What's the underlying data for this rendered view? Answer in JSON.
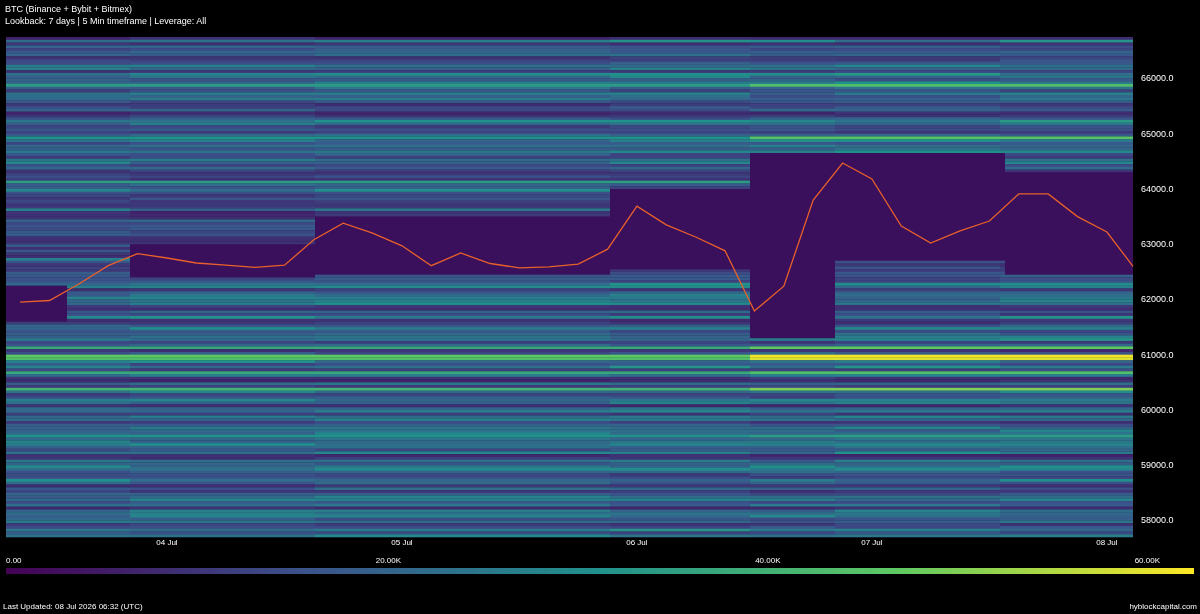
{
  "header": {
    "title": "BTC (Binance + Bybit + Bitmex)",
    "subtitle": "Lookback: 7 days | 5 Min timeframe | Leverage: All"
  },
  "chart": {
    "chart_data": {
      "type": "line",
      "ylim": [
        58000,
        66000
      ],
      "yticks": [
        {
          "value": 66000,
          "label": "66000.0"
        },
        {
          "value": 65000,
          "label": "65000.0"
        },
        {
          "value": 64000,
          "label": "64000.0"
        },
        {
          "value": 63000,
          "label": "63000.0"
        },
        {
          "value": 62000,
          "label": "62000.0"
        },
        {
          "value": 61000,
          "label": "61000.0"
        },
        {
          "value": 60000,
          "label": "60000.0"
        },
        {
          "value": 59000,
          "label": "59000.0"
        },
        {
          "value": 58000,
          "label": "58000.0"
        }
      ],
      "categories": [
        null,
        null,
        null,
        null,
        null,
        "04 Jul",
        null,
        null,
        null,
        null,
        null,
        null,
        null,
        "05 Jul",
        null,
        null,
        null,
        null,
        null,
        null,
        null,
        "06 Jul",
        null,
        null,
        null,
        null,
        null,
        null,
        null,
        "07 Jul",
        null,
        null,
        null,
        null,
        null,
        null,
        null,
        "08 Jul",
        null
      ],
      "series": [
        {
          "color": "#e8612a",
          "values": [
            61950,
            61980,
            62280,
            62610,
            62830,
            62750,
            62660,
            62620,
            62580,
            62620,
            63080,
            63380,
            63200,
            62970,
            62610,
            62840,
            62650,
            62570,
            62590,
            62640,
            62910,
            63690,
            63350,
            63130,
            62880,
            61790,
            62240,
            63800,
            64470,
            64180,
            63330,
            63020,
            63240,
            63420,
            63910,
            63910,
            63500,
            63220,
            62600
          ]
        }
      ]
    }
  },
  "color_scale": {
    "labels": [
      "0.00",
      "20.00K",
      "40.00K",
      "60.00K"
    ]
  },
  "footer": {
    "updated": "Last Updated: 08 Jul 2026 06:32 (UTC)",
    "site": "hyblockcapital.com"
  }
}
